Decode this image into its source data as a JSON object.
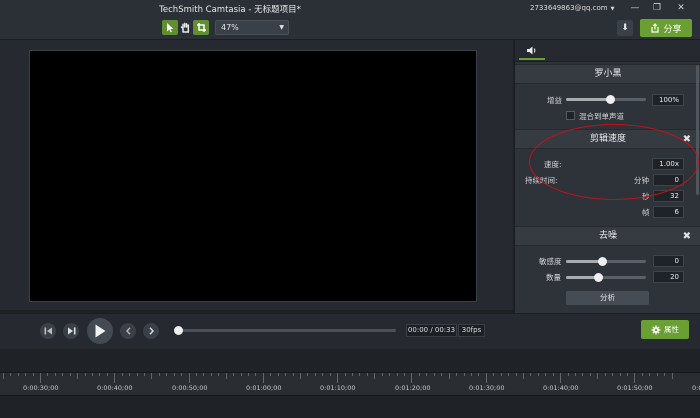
{
  "window": {
    "title": "TechSmith Camtasia - 无标题项目*",
    "account": "2733649863@qq.com",
    "controls": [
      "—",
      "❐",
      "✕"
    ]
  },
  "toolbar": {
    "zoom": "47%",
    "share_label": "分享"
  },
  "audio_panel": {
    "clip_title": "罗小黑",
    "gain_label": "增益",
    "gain_value": "100%",
    "gain_level": 0.55,
    "mix_mono_label": "混合到单声道",
    "clip_speed": {
      "title": "剪辑速度",
      "speed_label": "速度:",
      "speed_value": "1.00x",
      "duration_label": "持续时间:",
      "minutes_label": "分钟",
      "minutes_value": "0",
      "seconds_label": "秒",
      "seconds_value": "32",
      "frames_label": "帧",
      "frames_value": "6"
    },
    "denoise": {
      "title": "去噪",
      "sensitivity_label": "敏感度",
      "sensitivity_value": "0",
      "sensitivity_level": 0.45,
      "amount_label": "数量",
      "amount_value": "20",
      "amount_level": 0.4,
      "analyze_label": "分析"
    }
  },
  "playback": {
    "time_current": "00:00",
    "time_total": "00:33",
    "timecode": "00:00 / 00:33",
    "fps": "30fps",
    "properties_label": "属性",
    "progress": 0
  },
  "timeline": {
    "labels": [
      "0:00:30;00",
      "0:00:40;00",
      "0:00:50;00",
      "0:01:00;00",
      "0:01:10;00",
      "0:01:20;00",
      "0:01:30;00",
      "0:01:40;00",
      "0:01:50;00",
      "0:0"
    ]
  },
  "colors": {
    "accent_green": "#6aa033",
    "annotation_red": "#c2121a"
  }
}
